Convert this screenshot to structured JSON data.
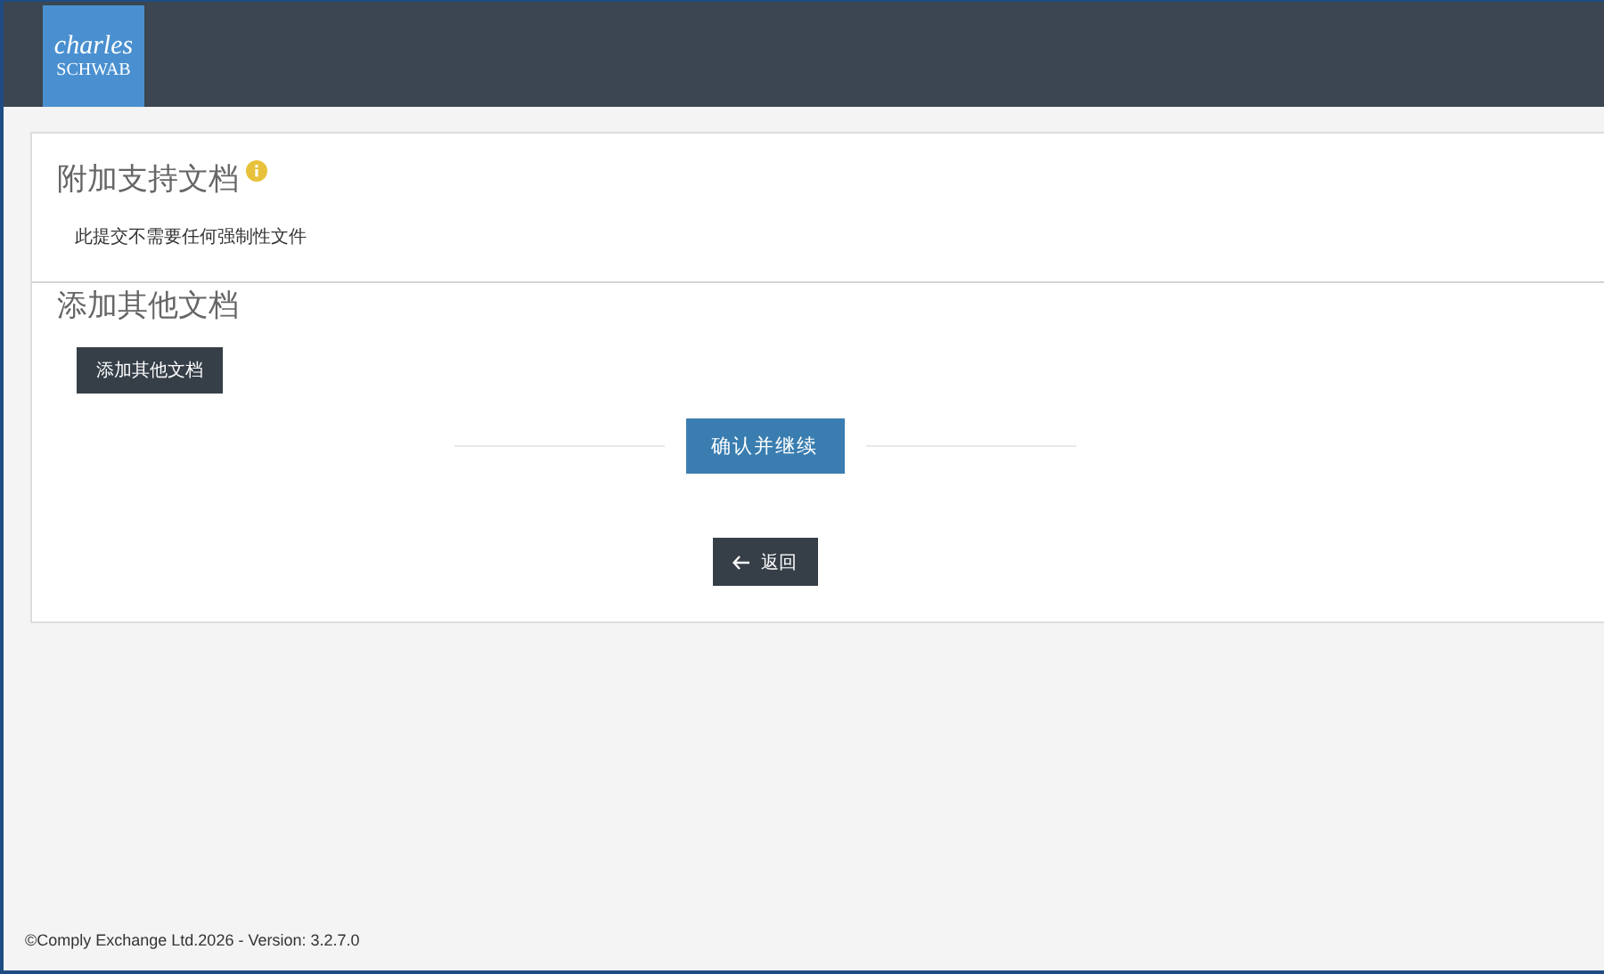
{
  "header": {
    "logo": {
      "line1": "charles",
      "line2": "SCHWAB"
    }
  },
  "sections": [
    {
      "title": "附加支持文档",
      "info": true,
      "text": "此提交不需要任何强制性文件"
    },
    {
      "title": "添加其他文档",
      "info": false,
      "button": "添加其他文档"
    }
  ],
  "confirm_button": "确认并继续",
  "back_button": "返回",
  "footer": "©Comply Exchange Ltd.2026 - Version: 3.2.7.0"
}
